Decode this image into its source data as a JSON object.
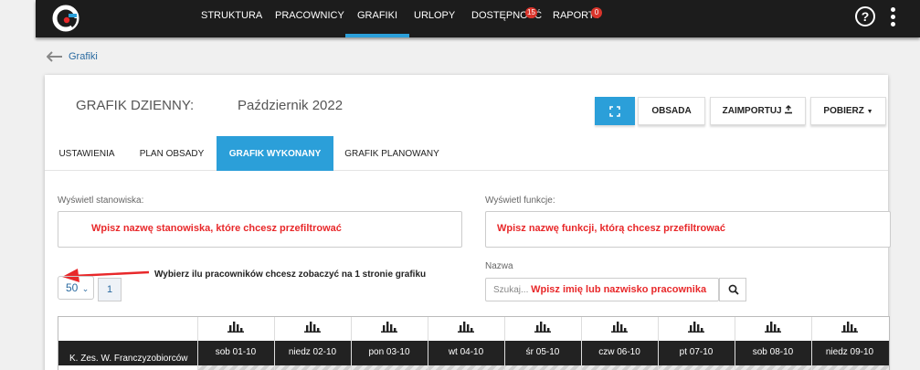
{
  "nav": {
    "items": [
      {
        "label": "STRUKTURA"
      },
      {
        "label": "PRACOWNICY"
      },
      {
        "label": "GRAFIKI",
        "active": true
      },
      {
        "label": "URLOPY"
      },
      {
        "label": "DOSTĘPNOŚĆ",
        "badge": "15"
      },
      {
        "label": "RAPORTY",
        "badge": "0"
      }
    ],
    "help_label": "?"
  },
  "breadcrumb": {
    "label": "Grafiki"
  },
  "header": {
    "title": "GRAFIK DZIENNY:",
    "subtitle": "Październik 2022"
  },
  "toolbar": {
    "fullscreen_icon": "expand-icon",
    "obsada_label": "OBSADA",
    "import_label": "ZAIMPORTUJ",
    "download_label": "POBIERZ"
  },
  "tabs": [
    {
      "label": "USTAWIENIA"
    },
    {
      "label": "PLAN OBSADY"
    },
    {
      "label": "GRAFIK WYKONANY",
      "active": true
    },
    {
      "label": "GRAFIK PLANOWANY"
    }
  ],
  "filters": {
    "positions_label": "Wyświetl stanowiska:",
    "positions_hint": "Wpisz nazwę stanowiska, które chcesz przefiltrować",
    "functions_label": "Wyświetl funkcje:",
    "functions_hint": "Wpisz nazwę funkcji, którą chcesz przefiltrować",
    "per_page_value": "50",
    "per_page_hint": "Wybierz ilu pracowników chcesz zobaczyć na 1 stronie grafiku",
    "page_number": "1",
    "name_label": "Nazwa",
    "search_placeholder": "Szukaj...",
    "search_hint": "Wpisz imię lub nazwisko pracownika"
  },
  "schedule": {
    "team": "K. Zes. W. Franczyzobiorców",
    "days": [
      "sob 01-10",
      "niedz 02-10",
      "pon 03-10",
      "wt 04-10",
      "śr 05-10",
      "czw 06-10",
      "pt 07-10",
      "sob 08-10",
      "niedz 09-10"
    ]
  },
  "colors": {
    "accent": "#2b9fd9",
    "topbar": "#1c1c1c",
    "annotation_red": "#e8282a"
  }
}
